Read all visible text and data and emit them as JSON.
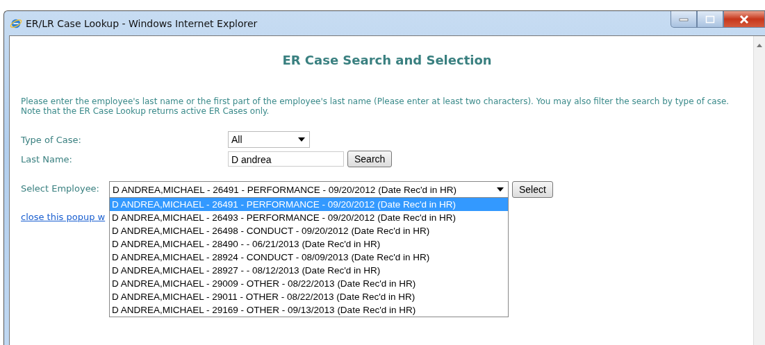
{
  "window": {
    "title": "ER/LR Case Lookup - Windows Internet Explorer"
  },
  "heading": "ER Case Search and Selection",
  "instructions": "Please enter the employee's last name or the first part of the employee's last name (Please enter at least two characters). You may also filter the search by type of case. Note that the ER Case Lookup returns active ER Cases only.",
  "type_of_case": {
    "label": "Type of Case:",
    "value": "All"
  },
  "last_name": {
    "label": "Last Name:",
    "value": "D andrea",
    "button": "Search"
  },
  "select_employee": {
    "label": "Select Employee:",
    "value": "D ANDREA,MICHAEL - 26491 - PERFORMANCE - 09/20/2012 (Date Rec'd in HR)",
    "button": "Select",
    "options": [
      {
        "text": "D ANDREA,MICHAEL - 26491 - PERFORMANCE - 09/20/2012 (Date Rec'd in HR)",
        "selected": true
      },
      {
        "text": "D ANDREA,MICHAEL - 26493 - PERFORMANCE - 09/20/2012 (Date Rec'd in HR)",
        "selected": false
      },
      {
        "text": "D ANDREA,MICHAEL - 26498 - CONDUCT - 09/20/2012 (Date Rec'd in HR)",
        "selected": false
      },
      {
        "text": "D ANDREA,MICHAEL - 28490 - - 06/21/2013 (Date Rec'd in HR)",
        "selected": false
      },
      {
        "text": "D ANDREA,MICHAEL - 28924 - CONDUCT - 08/09/2013 (Date Rec'd in HR)",
        "selected": false
      },
      {
        "text": "D ANDREA,MICHAEL - 28927 - - 08/12/2013 (Date Rec'd in HR)",
        "selected": false
      },
      {
        "text": "D ANDREA,MICHAEL - 29009 - OTHER - 08/22/2013 (Date Rec'd in HR)",
        "selected": false
      },
      {
        "text": "D ANDREA,MICHAEL - 29011 - OTHER - 08/22/2013 (Date Rec'd in HR)",
        "selected": false
      },
      {
        "text": "D ANDREA,MICHAEL - 29169 - OTHER - 09/13/2013 (Date Rec'd in HR)",
        "selected": false
      }
    ]
  },
  "close_link": "close this popup w"
}
